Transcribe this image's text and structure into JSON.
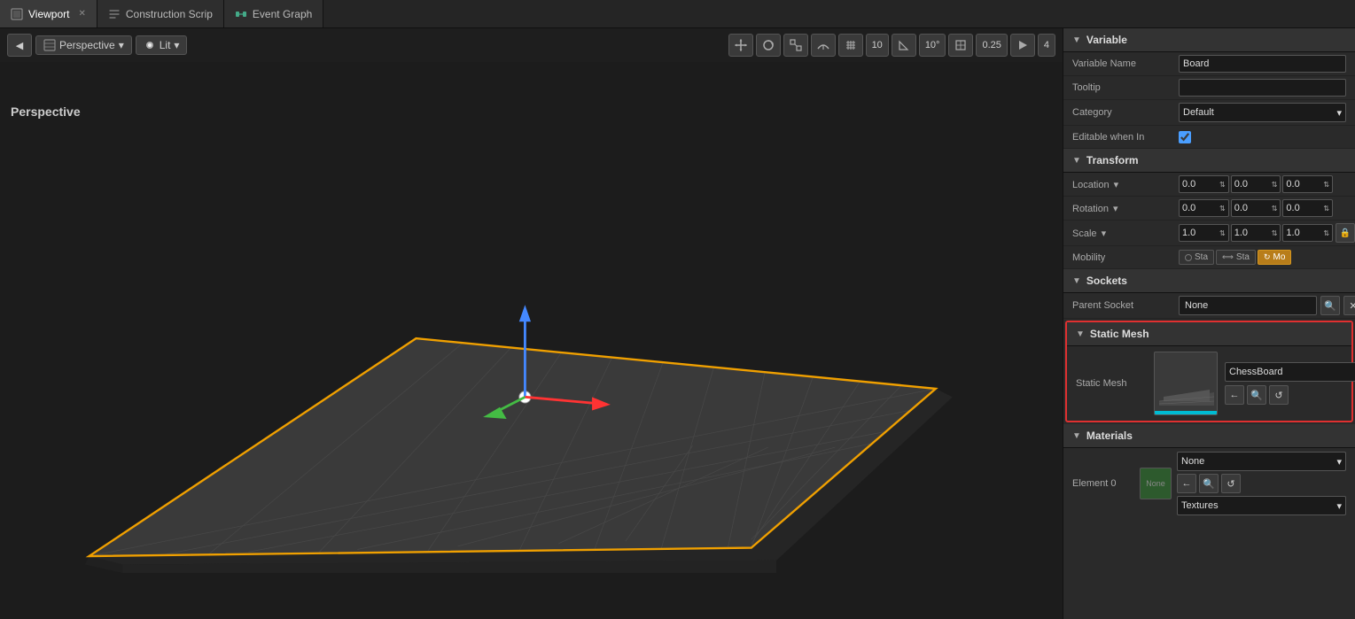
{
  "tabs": [
    {
      "id": "viewport",
      "label": "Viewport",
      "icon": "viewport",
      "active": true,
      "closeable": true
    },
    {
      "id": "construction",
      "label": "Construction Scrip",
      "icon": "script",
      "active": false,
      "closeable": false
    },
    {
      "id": "eventgraph",
      "label": "Event Graph",
      "icon": "graph",
      "active": false,
      "closeable": false
    }
  ],
  "toolbar": {
    "left_arrow_label": "◀",
    "perspective_label": "Perspective",
    "lit_label": "Lit",
    "buttons": [
      "⊕",
      "↺",
      "⤢",
      "▣",
      "⊞",
      "◇"
    ],
    "snap_translate": "10",
    "snap_rotate": "10°",
    "snap_scale": "0.25",
    "camera_speed": "4"
  },
  "perspective_label": "Perspective",
  "right_panel": {
    "variable_section": {
      "title": "Variable",
      "variable_name_label": "Variable Name",
      "variable_name_value": "Board",
      "tooltip_label": "Tooltip",
      "tooltip_value": "",
      "category_label": "Category",
      "category_value": "Default",
      "editable_label": "Editable when In",
      "editable_checked": true
    },
    "transform_section": {
      "title": "Transform",
      "location_label": "Location",
      "location_x": "0.0",
      "location_y": "0.0",
      "location_z": "0.0",
      "rotation_label": "Rotation",
      "rotation_x": "0.0",
      "rotation_y": "0.0",
      "rotation_z": "0.0",
      "scale_label": "Scale",
      "scale_x": "1.0",
      "scale_y": "1.0",
      "scale_z": "1.0",
      "mobility_label": "Mobility",
      "mobility_options": [
        "Sta",
        "Sta",
        "Mo"
      ],
      "mobility_active": 2
    },
    "sockets_section": {
      "title": "Sockets",
      "parent_socket_label": "Parent Socket",
      "parent_socket_value": "None"
    },
    "static_mesh_section": {
      "title": "Static Mesh",
      "label": "Static Mesh",
      "mesh_name": "ChessBoard",
      "highlighted": true
    },
    "materials_section": {
      "title": "Materials",
      "element0_label": "Element 0",
      "element0_value": "None",
      "none_label": "None",
      "textures_label": "Textures"
    }
  }
}
